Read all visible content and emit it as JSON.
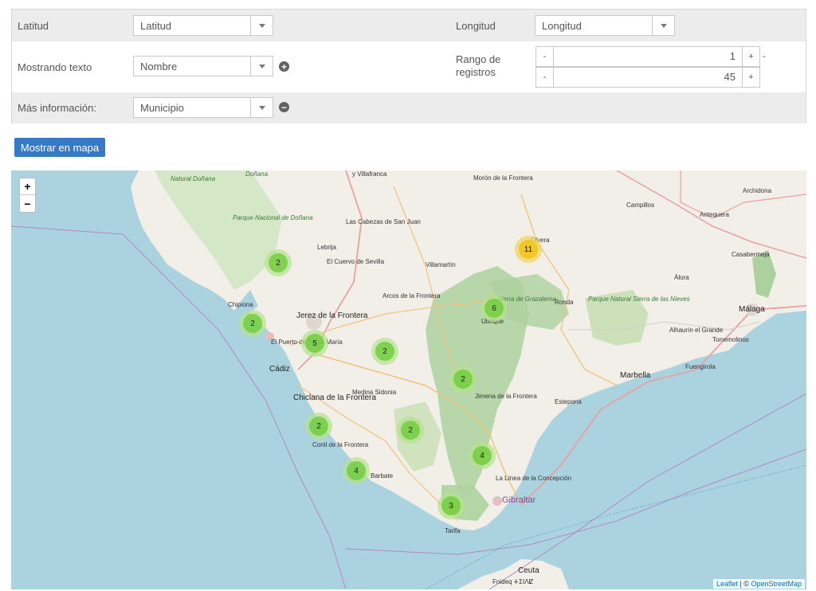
{
  "form": {
    "lat_label": "Latitud",
    "lat_select": "Latitud",
    "lon_label": "Longitud",
    "lon_select": "Longitud",
    "text_label": "Mostrando texto",
    "text_select": "Nombre",
    "range_label": "Rango de registros",
    "range_min": "1",
    "range_max": "45",
    "minus": "-",
    "plus": "+",
    "info_label": "Más información:",
    "info_select": "Municipio"
  },
  "show_button": "Mostrar en mapa",
  "map": {
    "zoom_in": "+",
    "zoom_out": "−",
    "attribution_leaflet": "Leaflet",
    "attribution_sep": " | © ",
    "attribution_osm": "OpenStreetMap",
    "clusters": [
      {
        "count": "2",
        "color": "green"
      },
      {
        "count": "2",
        "color": "green"
      },
      {
        "count": "5",
        "color": "green"
      },
      {
        "count": "2",
        "color": "green"
      },
      {
        "count": "2",
        "color": "green"
      },
      {
        "count": "2",
        "color": "green"
      },
      {
        "count": "2",
        "color": "green"
      },
      {
        "count": "4",
        "color": "green"
      },
      {
        "count": "4",
        "color": "green"
      },
      {
        "count": "3",
        "color": "green"
      },
      {
        "count": "6",
        "color": "green"
      },
      {
        "count": "11",
        "color": "yellow"
      }
    ],
    "places": [
      "Doñana",
      "Natural Doñana",
      "y Villafranca",
      "Morón de la Frontera",
      "Archidona",
      "Campillos",
      "Antequera",
      "Parque Nacional de Doñana",
      "Las Cabezas de San Juan",
      "Olvera",
      "Lebrija",
      "El Cuervo de Sevilla",
      "Villamartín",
      "Casabermeja",
      "Álora",
      "Chipiona",
      "Arcos de la Frontera",
      "Sierra de Grazalema",
      "Ronda",
      "Parque Natural Sierra de las Nieves",
      "Málaga",
      "Jerez de la Frontera",
      "Ubrique",
      "El Puerto de Santa María",
      "Alhaurín el Grande",
      "Torremolinos",
      "Cádiz",
      "Fuengirola",
      "Marbella",
      "Medina Sidonia",
      "Jimena de la Frontera",
      "Chiclana de la Frontera",
      "Estepona",
      "Conil de la Frontera",
      "Barbate",
      "La Línea de la Concepción",
      "Gibraltar",
      "Tarifa",
      "Ceuta",
      "Fnideq ⵜⵉⵏⴷⵇ"
    ],
    "colors": {
      "sea": "#aad3df",
      "land": "#f2efe9",
      "forest": "#add19e",
      "cluster_green": "#6ecc39",
      "cluster_yellow": "#f0c20c"
    }
  }
}
